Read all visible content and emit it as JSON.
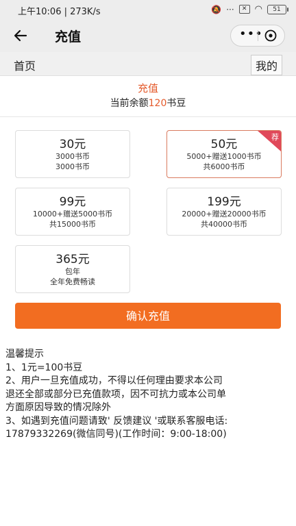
{
  "status_bar": {
    "time": "上午10:06 | 273K/s",
    "mute_icon": "bell-off-icon",
    "dots": "···",
    "battery": "51"
  },
  "title_bar": {
    "title": "充值",
    "more": "•••"
  },
  "nav": {
    "home": "首页",
    "mine": "我的"
  },
  "header": {
    "recharge_label": "充值",
    "balance_prefix": "当前余额",
    "balance_amount": "120",
    "balance_unit": "书豆"
  },
  "packages": [
    {
      "price": "30元",
      "line1": "3000书币",
      "line2": "3000书币",
      "selected": false
    },
    {
      "price": "50元",
      "line1": "5000+赠送1000书币",
      "line2": "共6000书币",
      "selected": true,
      "badge": "荐"
    },
    {
      "price": "99元",
      "line1": "10000+赠送5000书币",
      "line2": "共15000书币",
      "selected": false
    },
    {
      "price": "199元",
      "line1": "20000+赠送20000书币",
      "line2": "共40000书币",
      "selected": false
    },
    {
      "price": "365元",
      "line1": "包年",
      "line2": "全年免费畅读",
      "selected": false
    }
  ],
  "confirm_label": "确认充值",
  "tips": {
    "title": "温馨提示",
    "lines": [
      "1、1元=100书豆",
      "2、用户一旦充值成功，不得以任何理由要求本公司",
      "退还全部或部分已充值款项，因不可抗力或本公司单",
      "方面原因导致的情况除外",
      "3、如遇到充值问题请致' 反馈建议 '或联系客服电话:",
      "17879332269(微信同号)(工作时间：9:00-18:00)"
    ]
  },
  "colors": {
    "accent": "#f26d21",
    "highlight": "#e45a2b",
    "badge": "#e0495a"
  }
}
